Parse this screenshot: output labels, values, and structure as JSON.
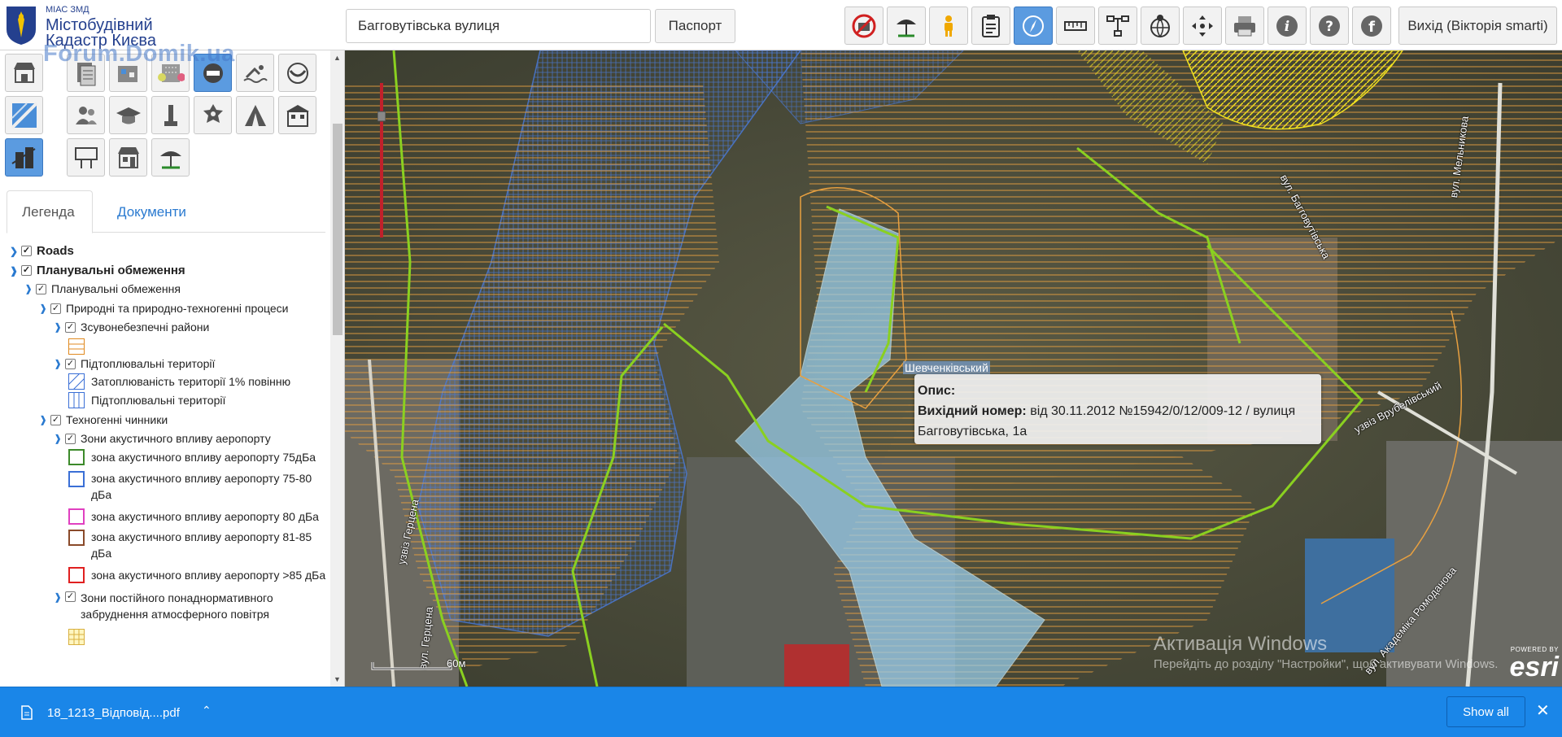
{
  "header": {
    "logo_small": "МІАС ЗМД",
    "logo_line1": "Містобудівний",
    "logo_line2": "Кадастр Києва",
    "watermark": "Forum.Domik.ua",
    "search_value": "Багговутівська вулиця",
    "passport_label": "Паспорт",
    "exit_label": "Вихід (Вікторія smarti)",
    "tools": [
      "no-building-icon",
      "beach-umbrella-icon",
      "person-icon",
      "clipboard-icon",
      "compass-icon",
      "ruler-icon",
      "network-icon",
      "globe-pin-icon",
      "move-arrows-icon",
      "printer-icon",
      "info-icon",
      "help-icon",
      "facebook-icon"
    ]
  },
  "sidebar": {
    "tiles": [
      "shop-icon",
      "document-layers-icon",
      "city-layer-icon",
      "cluster-icon",
      "no-entry-icon",
      "swimmer-icon",
      "wreath-icon",
      "map-tile-icon",
      "people-icon",
      "graduation-icon",
      "monument-icon",
      "police-icon",
      "tent-icon",
      "building-icon",
      "city-active-icon",
      "billboard-icon",
      "store-icon",
      "umbrella-icon"
    ],
    "tabs": {
      "legend": "Легенда",
      "documents": "Документи"
    },
    "legend": {
      "roads": "Roads",
      "planning": "Планувальні обмеження",
      "planning_sub": "Планувальні обмеження",
      "natural": "Природні та природно-техногенні процеси",
      "landslide": "Зсувонебезпечні райони",
      "flooding": "Підтоплювальні території",
      "flood1": "Затоплюваність території 1% повінню",
      "flood2": "Підтоплювальні території",
      "technogenic": "Техногенні чинники",
      "airport": "Зони акустичного впливу аеропорту",
      "a1": "зона акустичного впливу аеропорту 75дБа",
      "a2": "зона акустичного впливу аеропорту 75-80 дБа",
      "a3": "зона акустичного впливу аеропорту 80 дБа",
      "a4": "зона акустичного впливу аеропорту 81-85 дБа",
      "a5": "зона акустичного впливу аеропорту >85 дБа",
      "pollution": "Зони постійного понаднормативного забруднення атмосферного повітря"
    },
    "colors": {
      "a1": "#3c8a2a",
      "a2": "#3a6fd6",
      "a3": "#e040c0",
      "a4": "#8a4a2a",
      "a5": "#e02020"
    }
  },
  "map": {
    "popup_title": "Опис:",
    "popup_label": "Вихідний номер:",
    "popup_value": "від 30.11.2012 №15942/0/12/009-12 / вулиця Багговутівська, 1а",
    "area_label": "Шевченківський",
    "scale_label": "60м",
    "activate_title": "Активація Windows",
    "activate_text": "Перейдіть до розділу \"Настройки\", щоб активувати Windows.",
    "esri_powered": "POWERED BY",
    "esri_logo": "esri",
    "streets": [
      "вул. Багговутівська",
      "вул. Мельникова",
      "узвіз Герцена",
      "вул. Герцена",
      "узвіз Врубелівський",
      "вул. Академіка Ромоданова"
    ]
  },
  "downloads": {
    "file_name": "18_1213_Відповід....pdf",
    "show_all": "Show all"
  }
}
